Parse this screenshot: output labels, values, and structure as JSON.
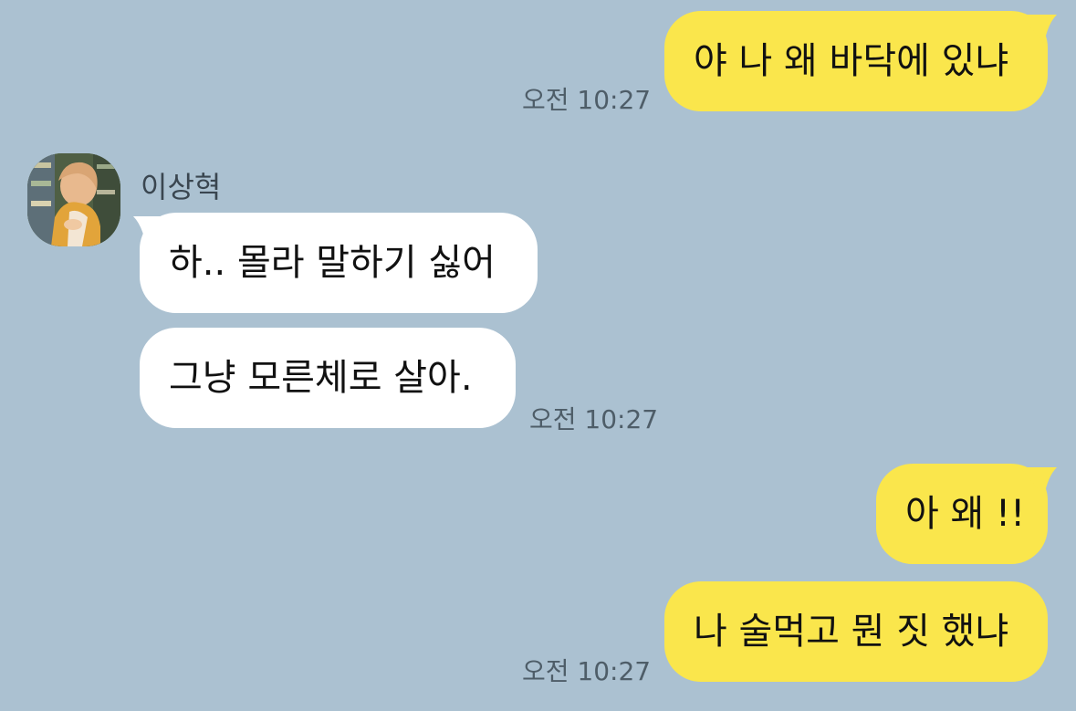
{
  "theme": {
    "background": "#abc1d1",
    "my_bubble_color": "#fae64c",
    "their_bubble_color": "#ffffff"
  },
  "contact": {
    "name": "이상혁",
    "avatar_icon": "profile-photo"
  },
  "messages": [
    {
      "sender": "me",
      "text": "야 나 왜 바닥에 있냐",
      "time": "오전 10:27"
    },
    {
      "sender": "them",
      "text": "하.. 몰라 말하기 싫어",
      "time": ""
    },
    {
      "sender": "them",
      "text": "그냥 모른체로 살아.",
      "time": "오전 10:27"
    },
    {
      "sender": "me",
      "text": "아 왜 !!",
      "time": ""
    },
    {
      "sender": "me",
      "text": "나 술먹고 뭔 짓 했냐",
      "time": "오전 10:27"
    }
  ]
}
